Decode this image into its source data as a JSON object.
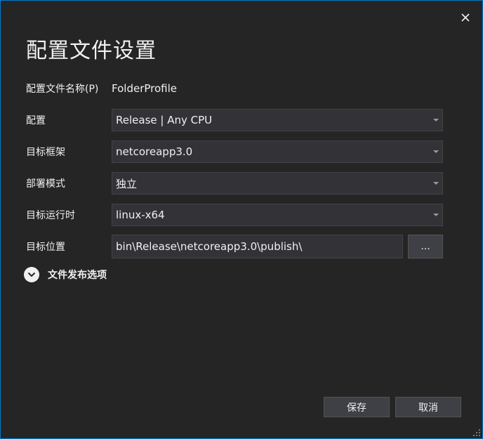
{
  "dialog": {
    "title": "配置文件设置",
    "close_icon": "close-icon"
  },
  "profile_name": {
    "label": "配置文件名称(P)",
    "value": "FolderProfile"
  },
  "configuration": {
    "label": "配置",
    "value": "Release | Any CPU"
  },
  "target_framework": {
    "label": "目标框架",
    "value": "netcoreapp3.0"
  },
  "deployment_mode": {
    "label": "部署模式",
    "value": "独立"
  },
  "target_runtime": {
    "label": "目标运行时",
    "value": "linux-x64"
  },
  "target_location": {
    "label": "目标位置",
    "value": "bin\\Release\\netcoreapp3.0\\publish\\",
    "browse_label": "..."
  },
  "file_publish_options": {
    "label": "文件发布选项",
    "icon": "chevron-down-icon"
  },
  "buttons": {
    "save": "保存",
    "cancel": "取消"
  },
  "colors": {
    "background": "#252526",
    "accent_border": "#007acc",
    "field_background": "#333337",
    "button_background": "#3f3f46"
  }
}
